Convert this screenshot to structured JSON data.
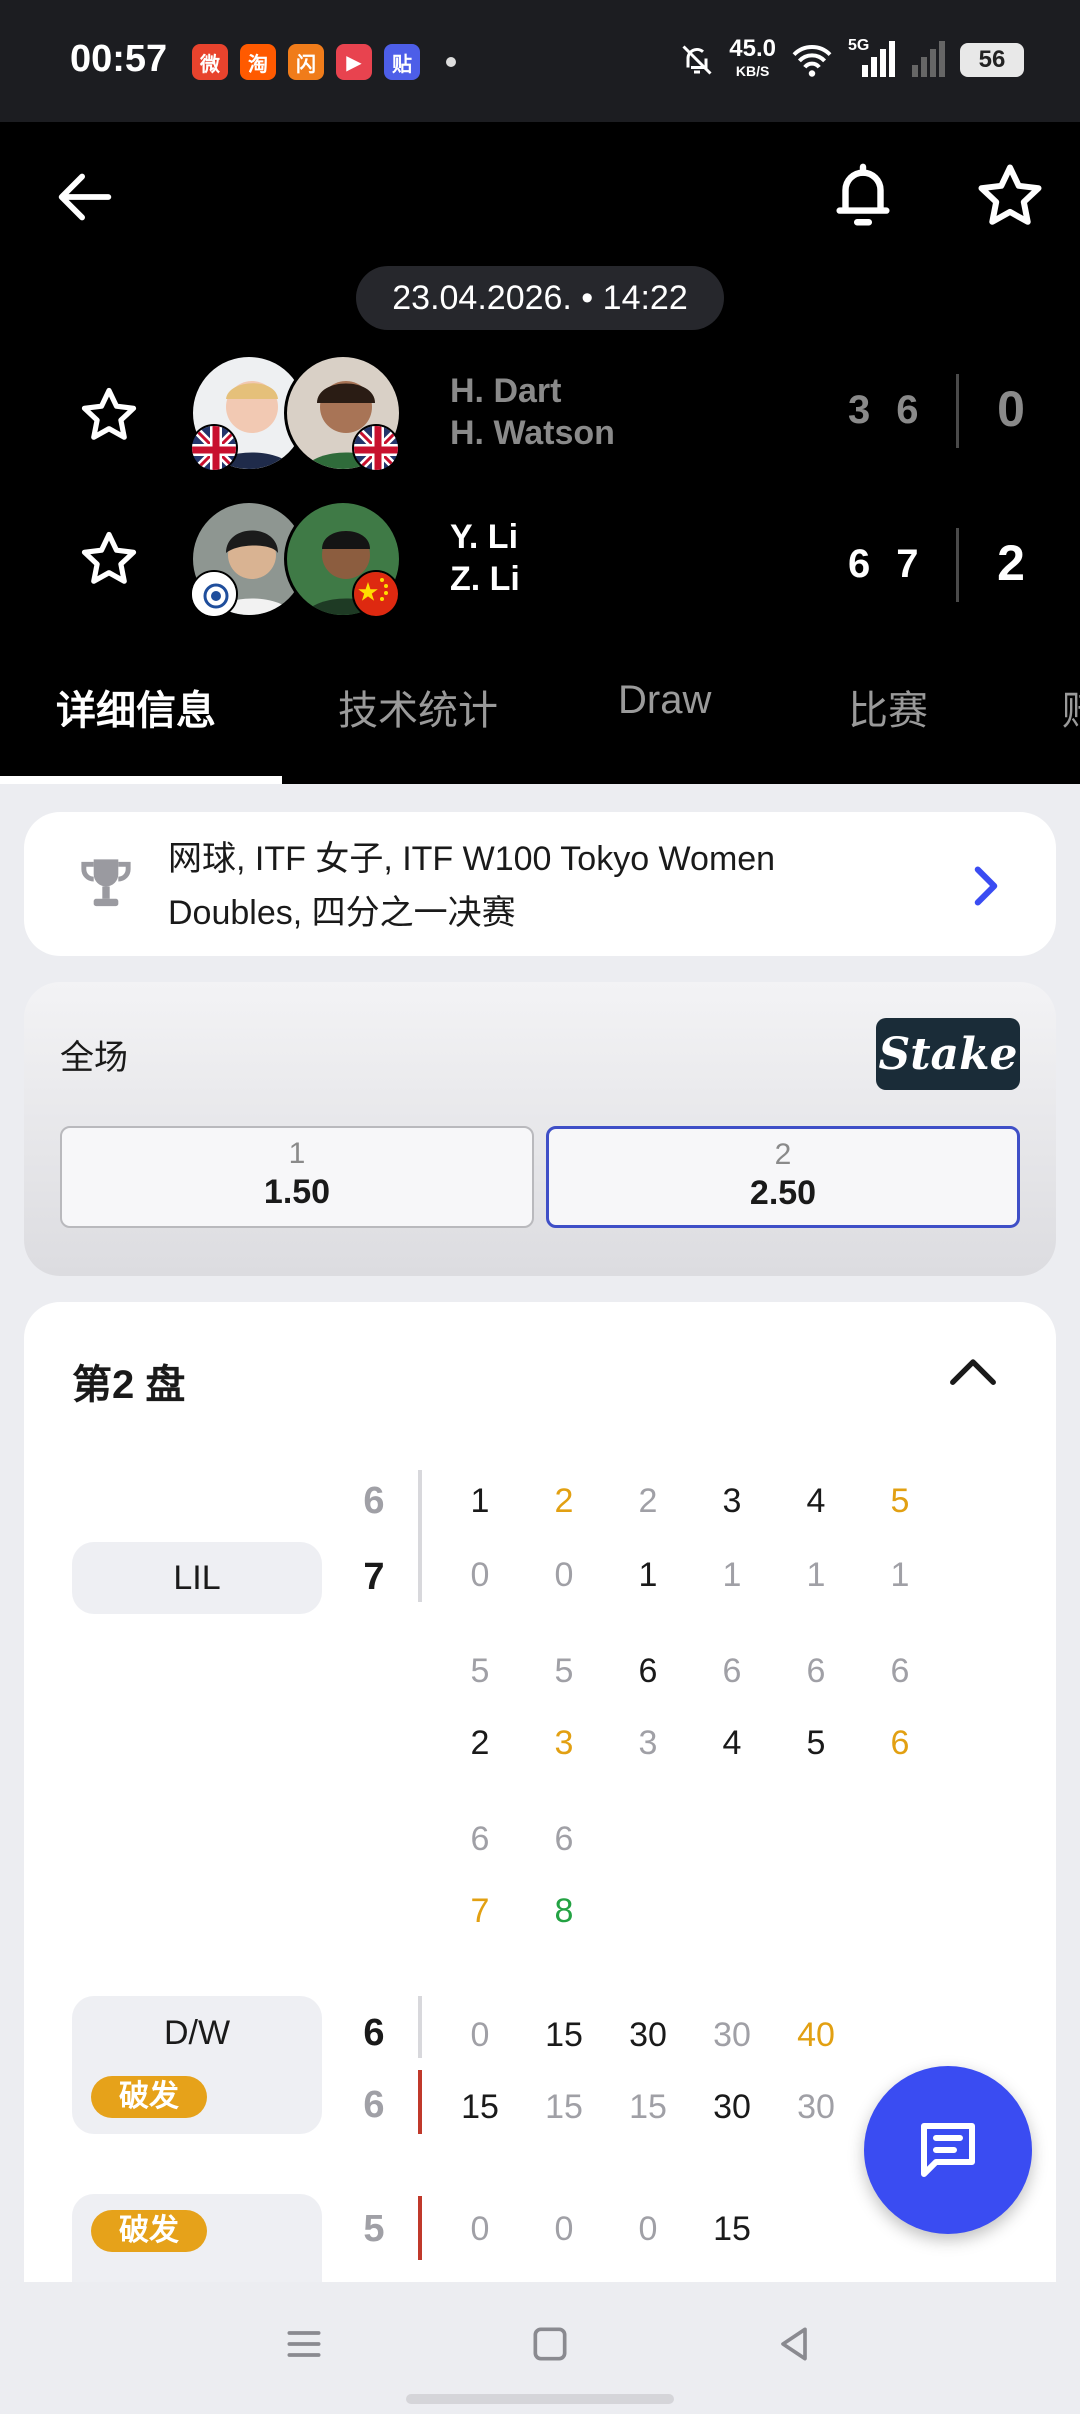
{
  "status_bar": {
    "time": "00:57",
    "apps": [
      {
        "name": "weibo-icon",
        "glyph": "微",
        "color": "#e8432d"
      },
      {
        "name": "taobao-icon",
        "glyph": "淘",
        "color": "#ff5a00"
      },
      {
        "name": "taobao-flash-icon",
        "glyph": "闪",
        "color": "#f07c1a"
      },
      {
        "name": "video-app-icon",
        "glyph": "▶",
        "color": "#e8434f"
      },
      {
        "name": "tieba-icon",
        "glyph": "贴",
        "color": "#4d5ee8"
      }
    ],
    "net_speed": "45.0",
    "net_speed_unit": "KB/S",
    "network_type": "5G",
    "battery": "56"
  },
  "header": {
    "datetime": "23.04.2026. • 14:22",
    "teams": [
      {
        "players": [
          "H. Dart",
          "H. Watson"
        ],
        "set_scores": [
          "3",
          "6"
        ],
        "total": "0",
        "flag": "gb"
      },
      {
        "players": [
          "Y. Li",
          "Z. Li"
        ],
        "set_scores": [
          "6",
          "7"
        ],
        "total": "2",
        "flag": "cn"
      }
    ]
  },
  "tabs": [
    {
      "label": "详细信息",
      "active": true
    },
    {
      "label": "技术统计",
      "active": false
    },
    {
      "label": "Draw",
      "active": false
    },
    {
      "label": "比赛",
      "active": false
    },
    {
      "label": "赔",
      "active": false
    }
  ],
  "breadcrumb": {
    "line1": "网球, ITF 女子, ITF W100 Tokyo Women",
    "line2": "Doubles, 四分之一决赛"
  },
  "odds": {
    "label": "全场",
    "bookmaker": "Stake",
    "options": [
      {
        "label": "1",
        "value": "1.50",
        "selected": false
      },
      {
        "label": "2",
        "value": "2.50",
        "selected": true
      }
    ]
  },
  "set_detail": {
    "title": "第2 盘",
    "tiebreak": {
      "team_label": "LIL",
      "set_top": "6",
      "set_bottom": "7",
      "rows": [
        [
          "1",
          "2",
          "2",
          "3",
          "4",
          "5"
        ],
        [
          "0",
          "0",
          "1",
          "1",
          "1",
          "1"
        ],
        [
          "5",
          "5",
          "6",
          "6",
          "6",
          "6"
        ],
        [
          "2",
          "3",
          "3",
          "4",
          "5",
          "6"
        ],
        [
          "6",
          "6"
        ],
        [
          "7",
          "8"
        ]
      ]
    },
    "games": [
      {
        "label": "D/W",
        "badge": "破发",
        "score_top": "6",
        "score_bottom": "6",
        "points_top": [
          "0",
          "15",
          "30",
          "30",
          "40"
        ],
        "points_bottom": [
          "15",
          "15",
          "15",
          "30",
          "30"
        ]
      },
      {
        "badge": "破发",
        "score": "5",
        "points": [
          "0",
          "0",
          "0",
          "15"
        ]
      }
    ]
  },
  "colors": {
    "accent_blue": "#3a4cf2",
    "highlight_orange": "#e2a012",
    "highlight_green": "#23a243",
    "break_badge": "#e6a21a"
  }
}
